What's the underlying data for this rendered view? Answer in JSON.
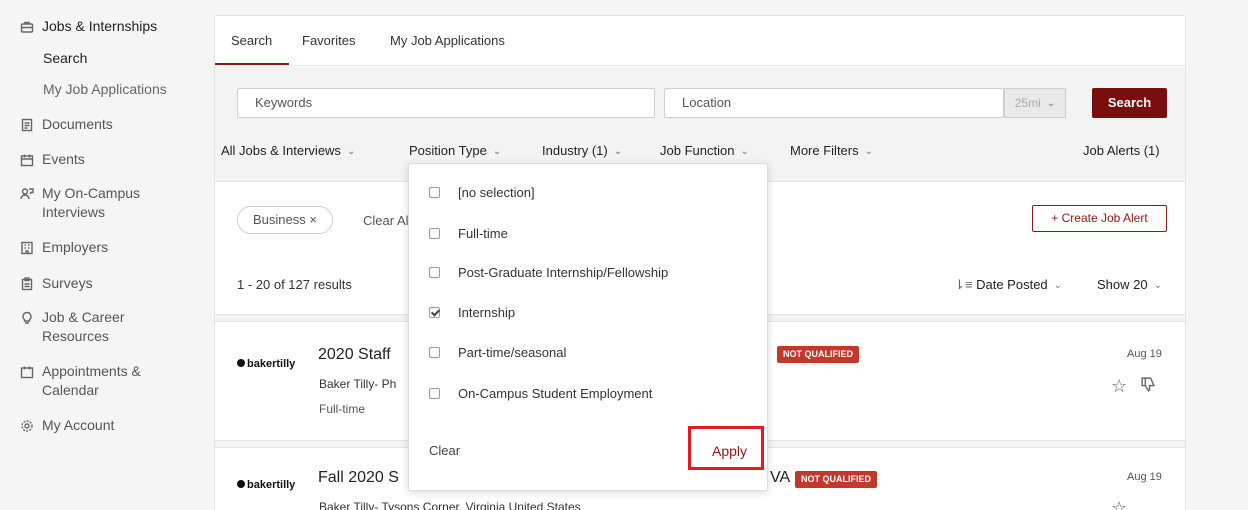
{
  "sidebar": {
    "items": [
      {
        "label": "Jobs & Internships",
        "icon": "briefcase-icon"
      },
      {
        "label": "Documents",
        "icon": "document-icon"
      },
      {
        "label": "Events",
        "icon": "calendar-icon"
      },
      {
        "label": "My On-Campus Interviews",
        "icon": "interview-icon"
      },
      {
        "label": "Employers",
        "icon": "building-icon"
      },
      {
        "label": "Surveys",
        "icon": "clipboard-icon"
      },
      {
        "label": "Job & Career Resources",
        "icon": "lightbulb-icon"
      },
      {
        "label": "Appointments & Calendar",
        "icon": "calendar-icon"
      },
      {
        "label": "My Account",
        "icon": "gear-icon"
      }
    ],
    "sub_items": [
      {
        "label": "Search",
        "active": true
      },
      {
        "label": "My Job Applications",
        "active": false
      }
    ]
  },
  "tabs": [
    {
      "label": "Search",
      "active": true
    },
    {
      "label": "Favorites",
      "active": false
    },
    {
      "label": "My Job Applications",
      "active": false
    }
  ],
  "search": {
    "keywords_placeholder": "Keywords",
    "location_placeholder": "Location",
    "radius": "25mi",
    "button": "Search"
  },
  "filters": [
    {
      "label": "All Jobs & Interviews"
    },
    {
      "label": "Position Type"
    },
    {
      "label": "Industry (1)"
    },
    {
      "label": "Job Function"
    },
    {
      "label": "More Filters"
    }
  ],
  "job_alerts": "Job Alerts (1)",
  "active_chip": "Business ×",
  "clear_all": "Clear Al",
  "create_alert": "+ Create Job Alert",
  "results_text": "1 - 20 of 127 results",
  "sort_label": "Date Posted",
  "show_label": "Show 20",
  "jobs": [
    {
      "logo": "bakertilly",
      "title": "2020 Staff",
      "company": "Baker Tilly- Ph",
      "type": "Full-time",
      "badge": "NOT QUALIFIED",
      "date": "Aug 19"
    },
    {
      "logo": "bakertilly",
      "title": "Fall 2020 S",
      "title_tail": "VA",
      "company": "Baker Tilly- Tysons Corner, Virginia United States",
      "badge": "NOT QUALIFIED",
      "date": "Aug 19"
    }
  ],
  "dropdown": {
    "options": [
      {
        "label": "[no selection]",
        "checked": false
      },
      {
        "label": "Full-time",
        "checked": false
      },
      {
        "label": "Post-Graduate Internship/Fellowship",
        "checked": false
      },
      {
        "label": "Internship",
        "checked": true
      },
      {
        "label": "Part-time/seasonal",
        "checked": false
      },
      {
        "label": "On-Campus Student Employment",
        "checked": false
      }
    ],
    "clear": "Clear",
    "apply": "Apply"
  },
  "colors": {
    "brand": "#7a0e0e",
    "badge": "#c0392b",
    "highlight": "#e31b23"
  }
}
